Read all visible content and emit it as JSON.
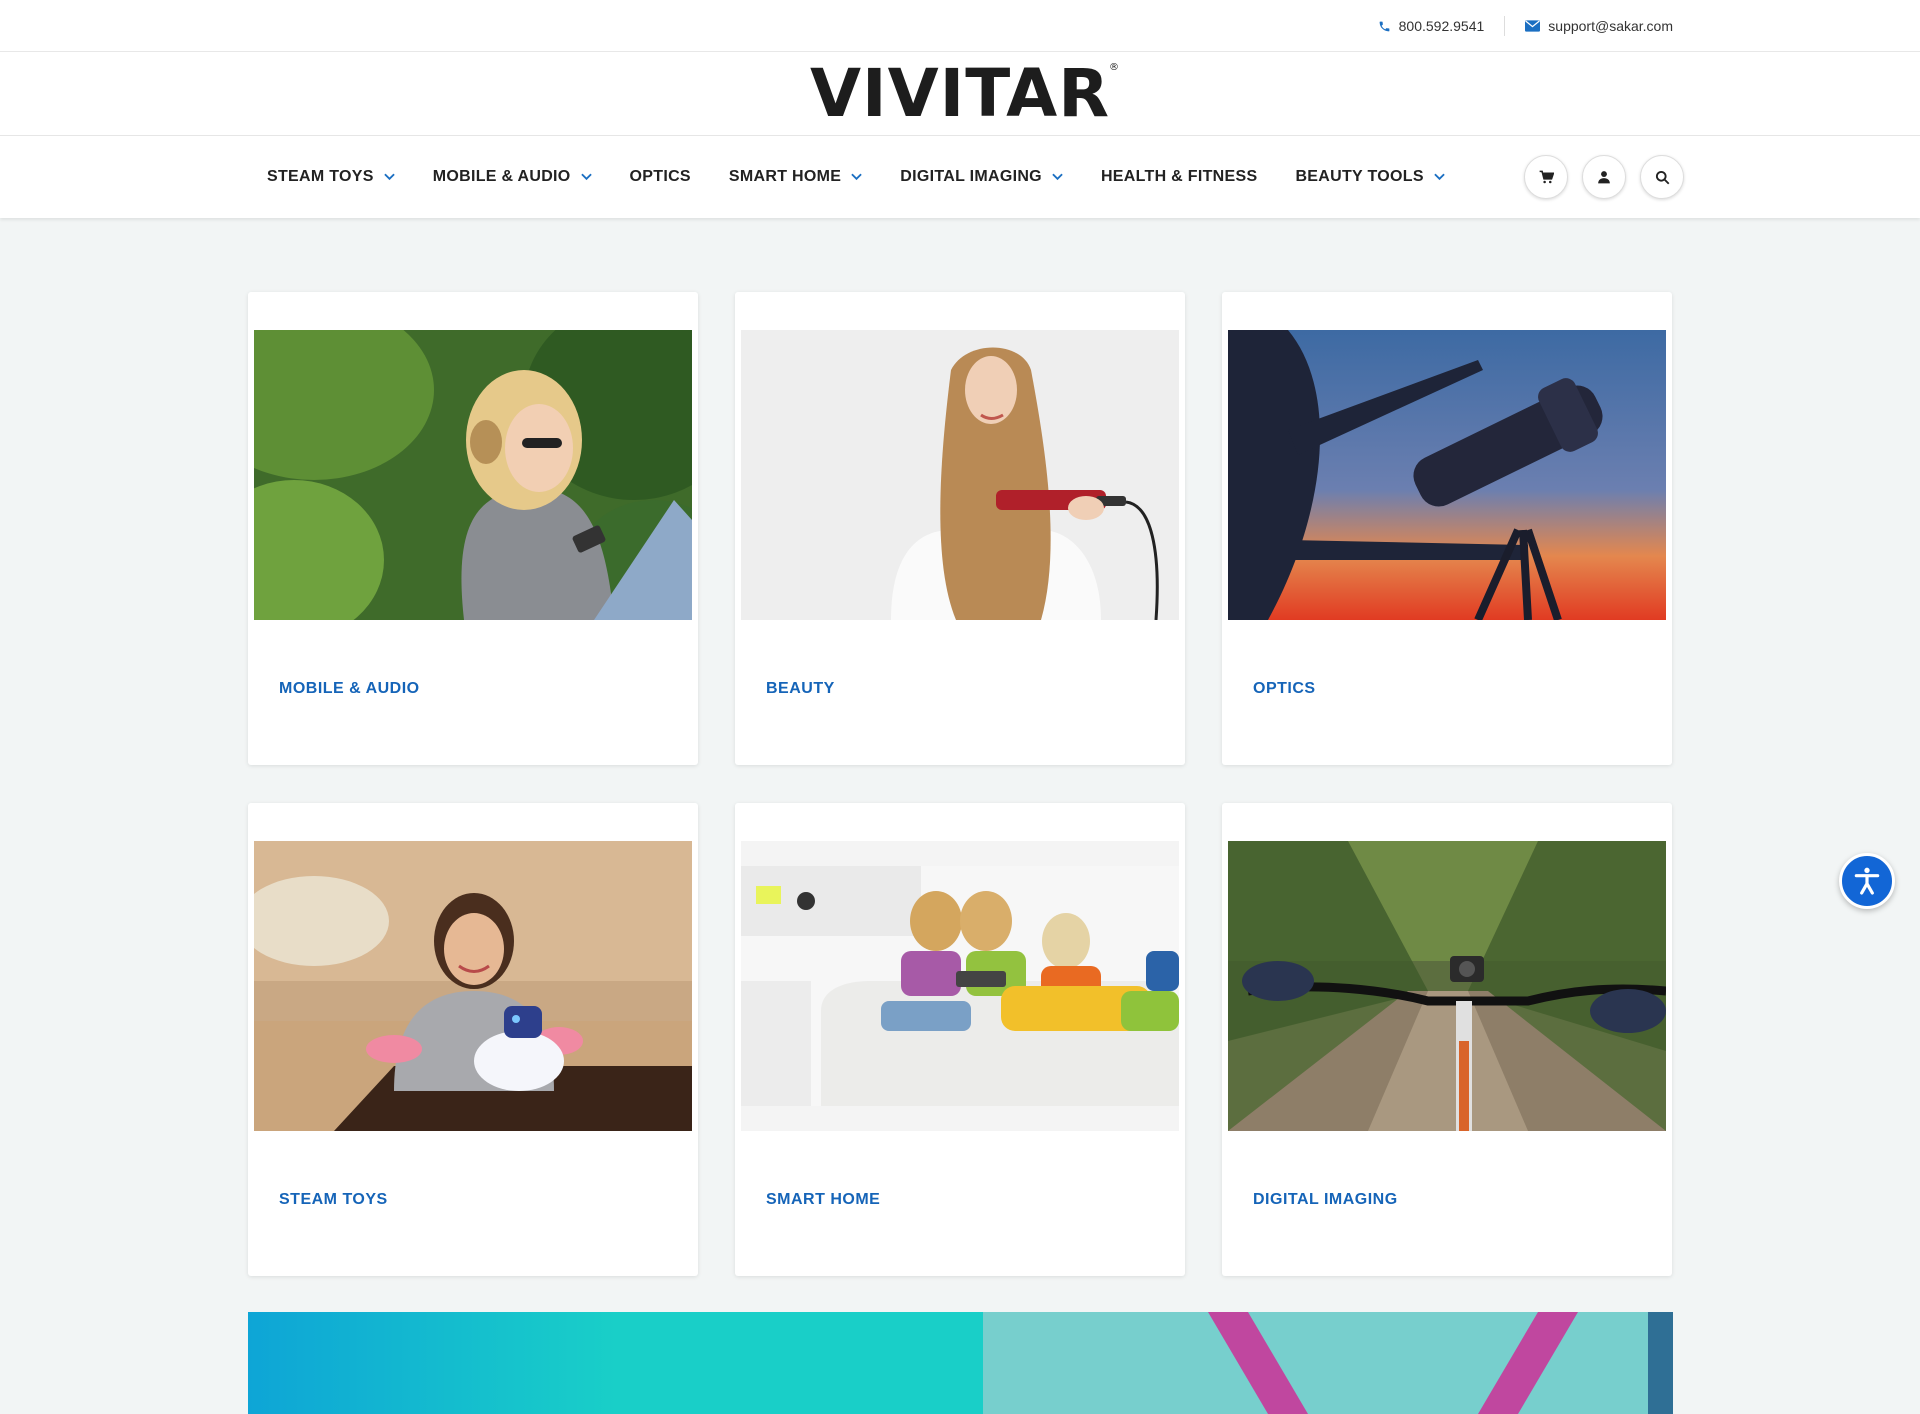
{
  "topbar": {
    "phone": "800.592.9541",
    "email": "support@sakar.com"
  },
  "logo": {
    "text": "VIVITAR",
    "mark": "®"
  },
  "nav": {
    "items": [
      {
        "label": "STEAM TOYS",
        "has_dropdown": true
      },
      {
        "label": "MOBILE & AUDIO",
        "has_dropdown": true
      },
      {
        "label": "OPTICS",
        "has_dropdown": false
      },
      {
        "label": "SMART HOME",
        "has_dropdown": true
      },
      {
        "label": "DIGITAL IMAGING",
        "has_dropdown": true
      },
      {
        "label": "HEALTH & FITNESS",
        "has_dropdown": false
      },
      {
        "label": "BEAUTY TOOLS",
        "has_dropdown": true
      }
    ],
    "icons": [
      "cart-icon",
      "user-icon",
      "search-icon"
    ]
  },
  "categories": [
    {
      "label": "MOBILE & AUDIO",
      "image": "woman-headphones-phone-photo"
    },
    {
      "label": "BEAUTY",
      "image": "woman-hair-straightener-photo"
    },
    {
      "label": "OPTICS",
      "image": "telescope-sunset-photo"
    },
    {
      "label": "STEAM TOYS",
      "image": "girl-robot-dog-photo"
    },
    {
      "label": "SMART HOME",
      "image": "kids-tablet-sofa-photo"
    },
    {
      "label": "DIGITAL IMAGING",
      "image": "bike-action-camera-photo"
    }
  ],
  "colors": {
    "accent": "#1564b8",
    "nav_chevron": "#1b6fc2",
    "accessibility_button": "#1266d6"
  }
}
